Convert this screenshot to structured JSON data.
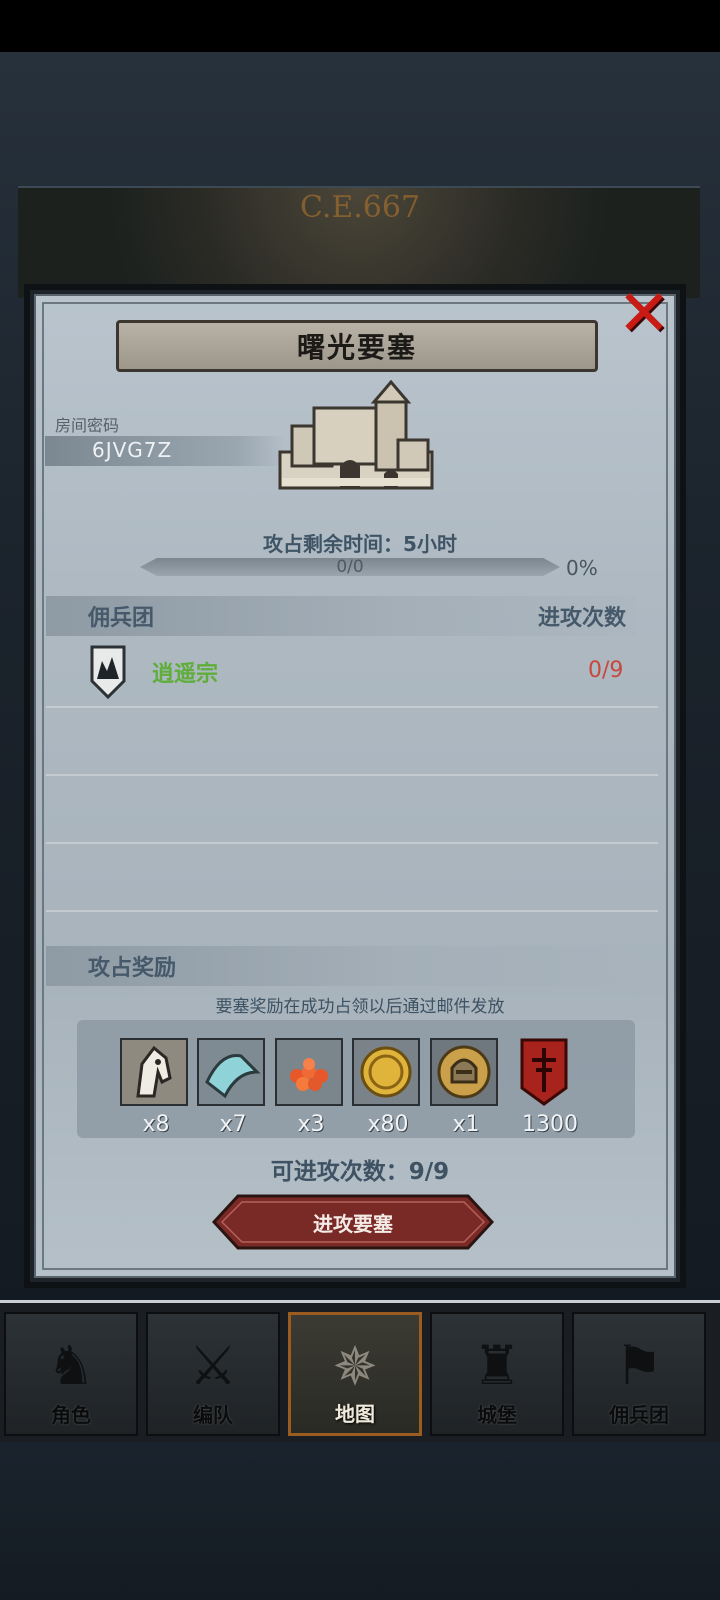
{
  "scene": {
    "year": "C.E.667"
  },
  "dialog": {
    "title": "曙光要塞",
    "room_label": "房间密码",
    "room_code": "6JVG7Z",
    "time_text": "攻占剩余时间：5小时",
    "progress": {
      "text": "0/0",
      "percent_text": "0%",
      "fraction": 0.0
    },
    "guild_header": "佣兵团",
    "attack_count_header": "进攻次数",
    "guilds": [
      {
        "name": "逍遥宗",
        "count": "0/9",
        "icon": "guild-crest-icon"
      }
    ],
    "reward_header": "攻占奖励",
    "reward_note": "要塞奖励在成功占领以后通过邮件发放",
    "rewards": [
      {
        "icon": "horse-icon",
        "qty": "x8"
      },
      {
        "icon": "cloth-icon",
        "qty": "x7"
      },
      {
        "icon": "beans-icon",
        "qty": "x3"
      },
      {
        "icon": "gold-coin-icon",
        "qty": "x80"
      },
      {
        "icon": "helmet-medal-icon",
        "qty": "x1"
      },
      {
        "icon": "banner-icon",
        "qty": "1300"
      }
    ],
    "attempts_text": "可进攻次数：9/9",
    "attack_button": "进攻要塞"
  },
  "nav": {
    "tabs": [
      {
        "label": "角色",
        "icon": "character-icon",
        "active": false
      },
      {
        "label": "编队",
        "icon": "formation-icon",
        "active": false
      },
      {
        "label": "地图",
        "icon": "compass-icon",
        "active": true
      },
      {
        "label": "城堡",
        "icon": "castle-icon",
        "active": false
      },
      {
        "label": "佣兵团",
        "icon": "mercenary-icon",
        "active": false
      }
    ]
  },
  "colors": {
    "accent_red": "#c91b14",
    "guild_green": "#5fae3b",
    "count_red": "#c8473f"
  }
}
